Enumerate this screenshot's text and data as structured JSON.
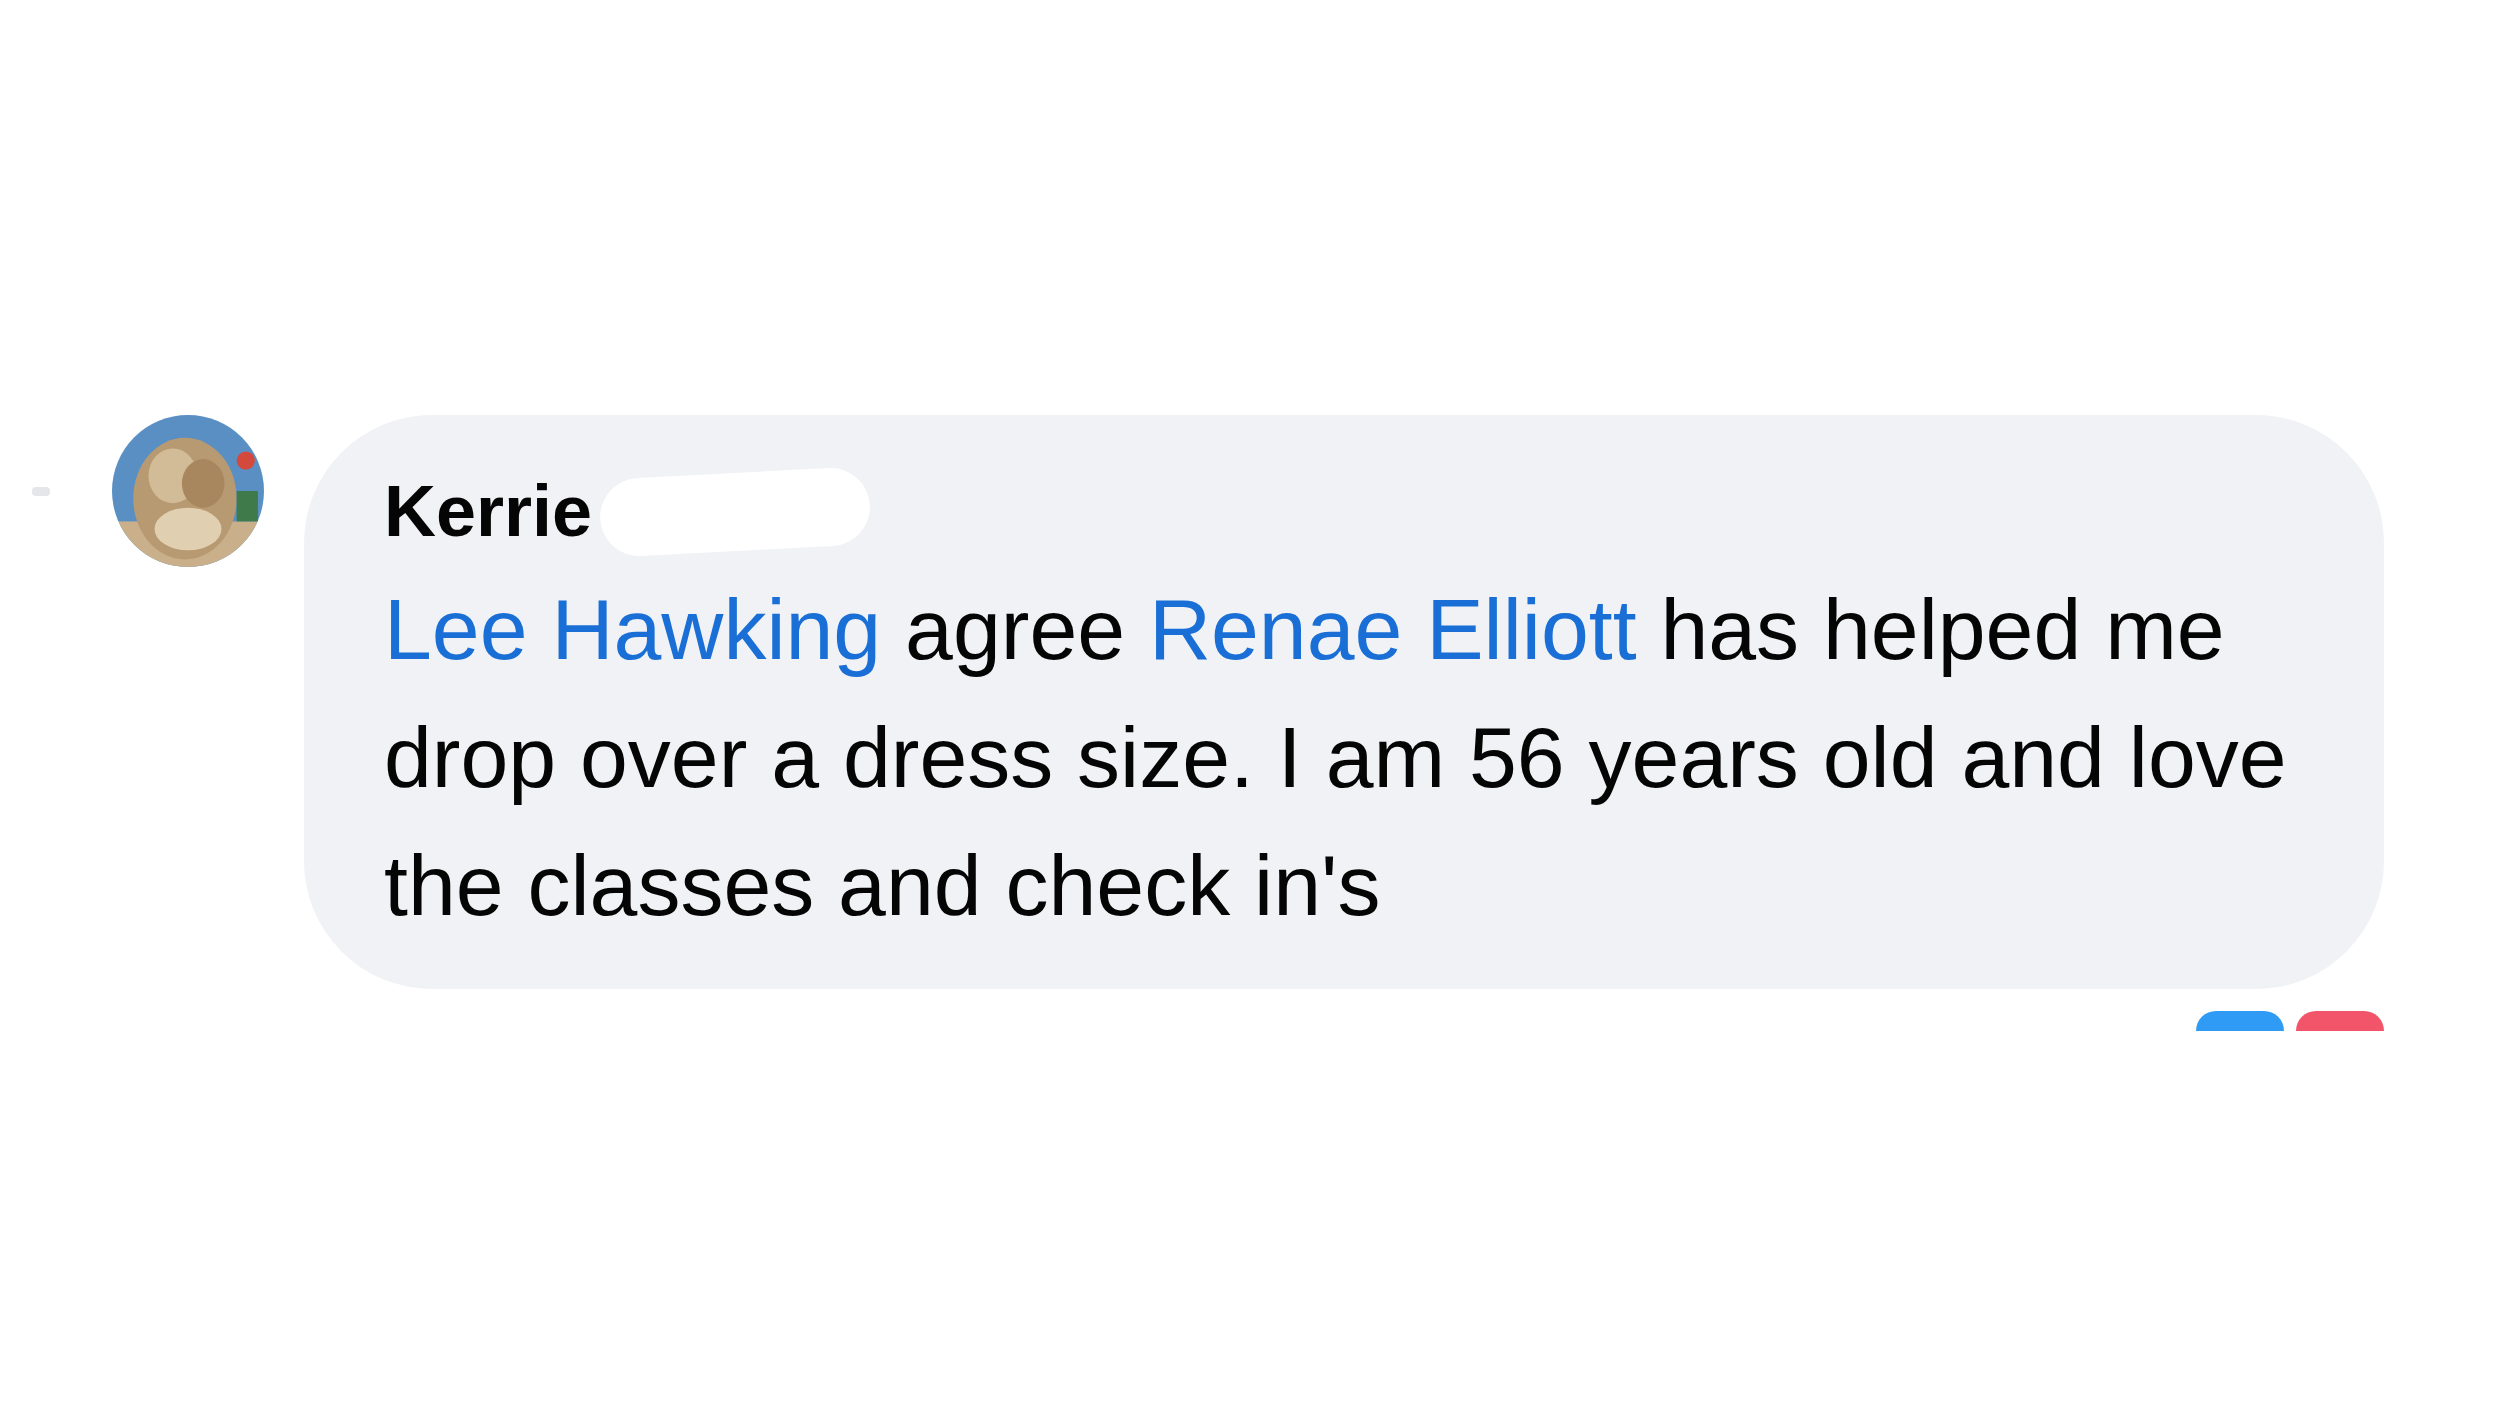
{
  "comment": {
    "author": "Kerrie",
    "body": [
      {
        "kind": "mention",
        "text": "Lee Hawking"
      },
      {
        "kind": "text",
        "text": " agree "
      },
      {
        "kind": "mention",
        "text": "Renae Elliott"
      },
      {
        "kind": "text",
        "text": " has helped me drop over a dress size. I am 56 years old and love the classes and check in's"
      }
    ],
    "reactions": [
      {
        "kind": "like"
      },
      {
        "kind": "love"
      }
    ]
  }
}
